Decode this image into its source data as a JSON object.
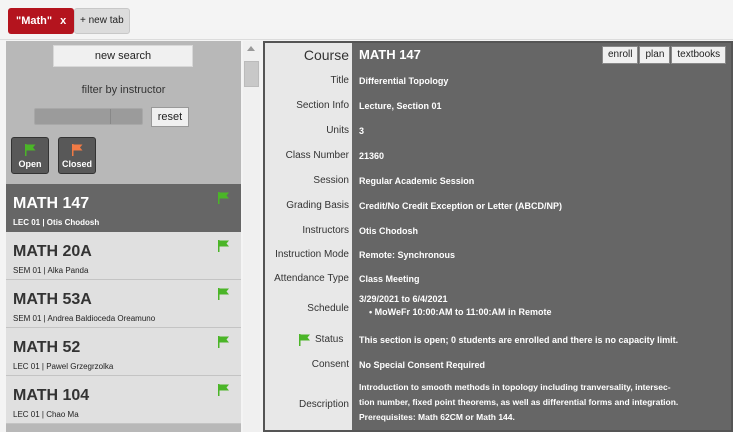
{
  "tabs": {
    "active_label": "\"Math\"",
    "close_label": "x",
    "new_tab_label": "+ new tab"
  },
  "sidebar": {
    "new_search_label": "new search",
    "filter_label": "filter by instructor",
    "reset_label": "reset",
    "open_label": "Open",
    "closed_label": "Closed",
    "colors": {
      "open_flag": "#4bb528",
      "closed_flag": "#f07a45"
    },
    "courses": [
      {
        "code": "MATH 147",
        "sub": "LEC 01 | Otis Chodosh",
        "flag": "flag-icon"
      },
      {
        "code": "MATH 20A",
        "sub": "SEM 01 | Alka Panda",
        "flag": "flag-icon"
      },
      {
        "code": "MATH 53A",
        "sub": "SEM 01 | Andrea Baldioceda Oreamuno",
        "flag": "flag-icon"
      },
      {
        "code": "MATH 52",
        "sub": "LEC 01 | Pawel Grzegrzolka",
        "flag": "flag-icon"
      },
      {
        "code": "MATH 104",
        "sub": "LEC 01 | Chao Ma",
        "flag": "flag-icon"
      }
    ]
  },
  "detail": {
    "course_label": "Course",
    "course_value": "MATH 147",
    "actions": [
      "enroll",
      "plan",
      "textbooks"
    ],
    "fields": [
      {
        "label": "Title",
        "value": "Differential Topology"
      },
      {
        "label": "Section Info",
        "value": "Lecture, Section 01"
      },
      {
        "label": "Units",
        "value": "3"
      },
      {
        "label": "Class Number",
        "value": "21360"
      },
      {
        "label": "Session",
        "value": "Regular Academic Session"
      },
      {
        "label": "Grading Basis",
        "value": "Credit/No Credit Exception or Letter (ABCD/NP)"
      },
      {
        "label": "Instructors",
        "value": "Otis Chodosh"
      },
      {
        "label": "Instruction Mode",
        "value": "Remote: Synchronous"
      },
      {
        "label": "Attendance Type",
        "value": "Class Meeting"
      }
    ],
    "schedule_label": "Schedule",
    "schedule_dates": "3/29/2021 to 6/4/2021",
    "schedule_item": "MoWeFr 10:00:AM to 11:00:AM in Remote",
    "status_label": "Status",
    "status_value": "This section is open; 0 students are enrolled and there is no capacity limit.",
    "consent_label": "Consent",
    "consent_value": "No Special Consent Required",
    "description_label": "Description",
    "description_lines": [
      "Introduction to smooth methods in topology including tranversality, intersec-",
      "tion number, fixed point theorems, as well as differential forms and integration.",
      "Prerequisites: Math 62CM or Math 144."
    ]
  }
}
